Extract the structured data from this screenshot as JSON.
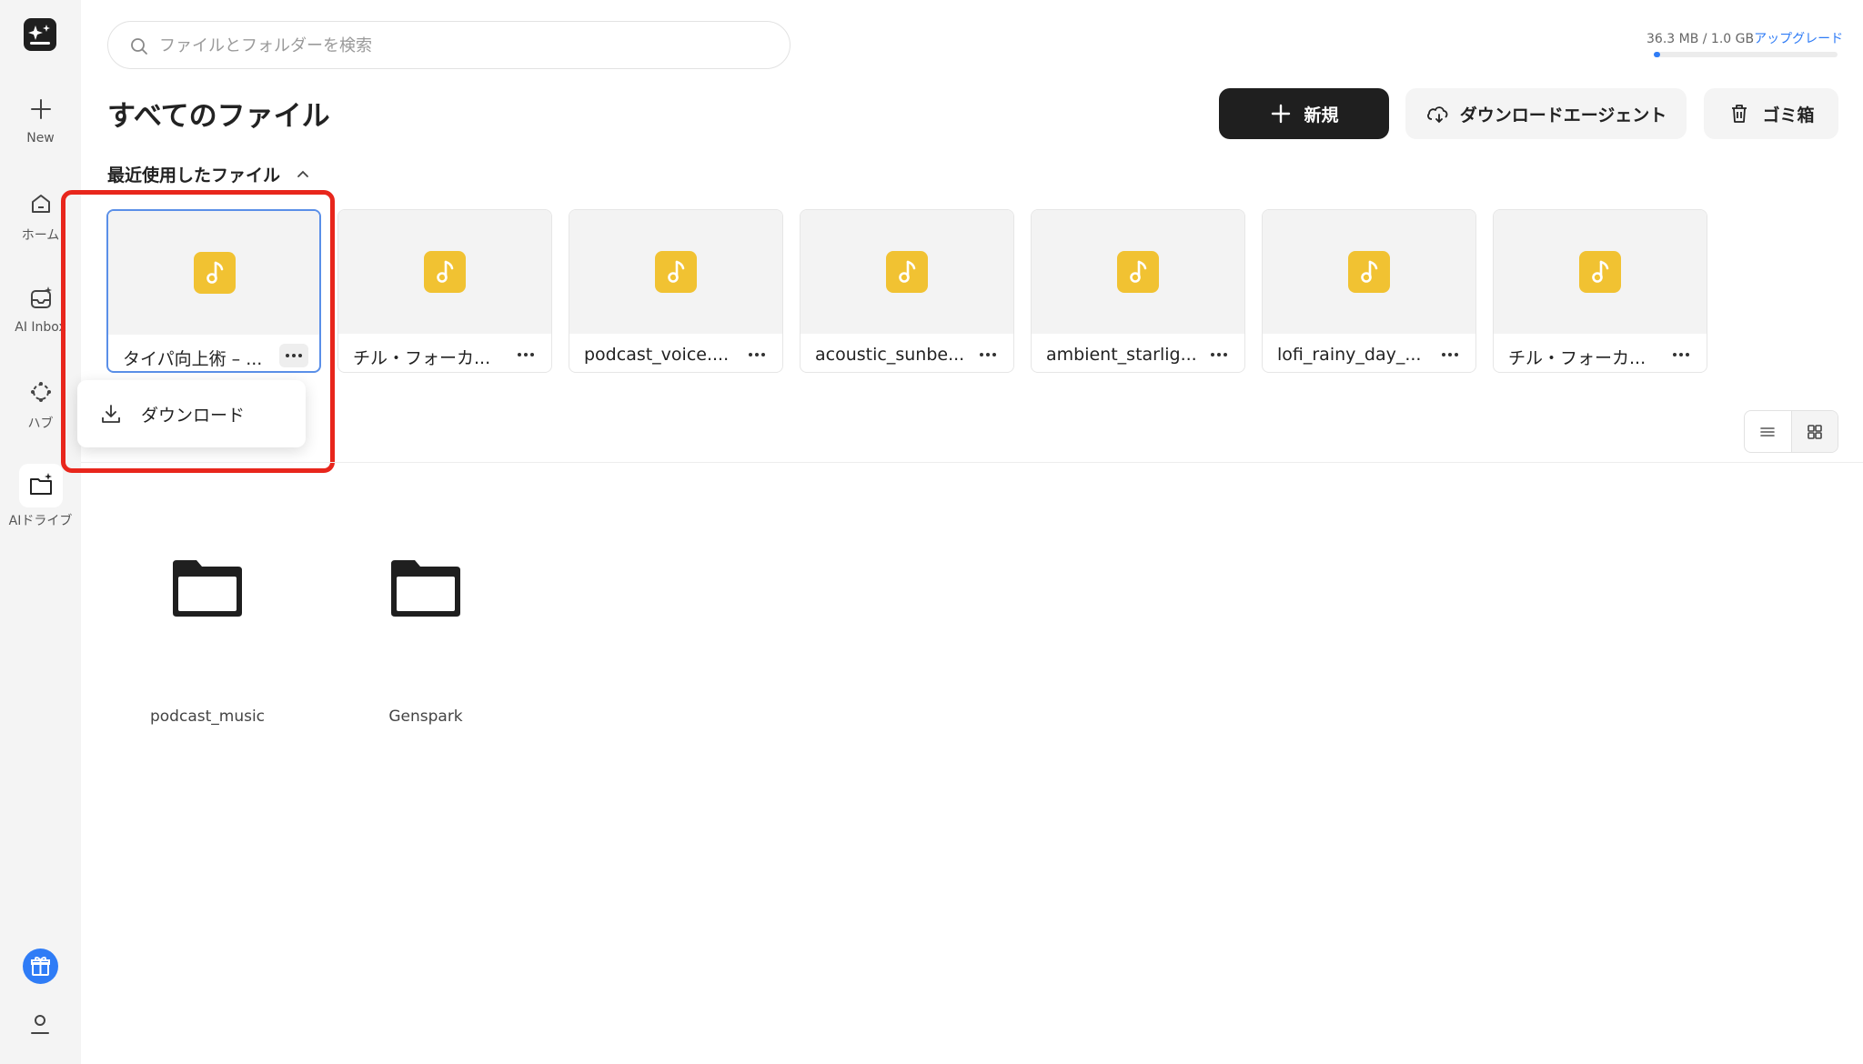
{
  "sidebar": {
    "logo_icon": "sparkle-logo-icon",
    "items": [
      {
        "label": "New",
        "icon": "plus-icon"
      },
      {
        "label": "ホーム",
        "icon": "home-icon"
      },
      {
        "label": "AI Inbox",
        "icon": "ai-inbox-icon"
      },
      {
        "label": "ハブ",
        "icon": "hub-icon"
      },
      {
        "label": "AIドライブ",
        "icon": "ai-drive-icon"
      }
    ],
    "gift_icon": "gift-icon",
    "user_icon": "user-icon"
  },
  "search": {
    "placeholder": "ファイルとフォルダーを検索"
  },
  "storage": {
    "usage": "36.3 MB / 1.0 GB",
    "upgrade": "アップグレード",
    "used_fraction": 0.035,
    "accent": "#2f7cf6"
  },
  "page": {
    "title": "すべてのファイル"
  },
  "toolbar": {
    "new_label": "新規",
    "agent_label": "ダウンロードエージェント",
    "trash_label": "ゴミ箱"
  },
  "recent": {
    "header": "最近使用したファイル",
    "files": [
      {
        "name": "タイパ向上術 – ..."
      },
      {
        "name": "チル・フォーカ..."
      },
      {
        "name": "podcast_voice...."
      },
      {
        "name": "acoustic_sunbe..."
      },
      {
        "name": "ambient_starlig..."
      },
      {
        "name": "lofi_rainy_day_..."
      },
      {
        "name": "チル・フォーカ..."
      }
    ]
  },
  "context_menu": {
    "download_label": "ダウンロード"
  },
  "folders": [
    {
      "name": "podcast_music"
    },
    {
      "name": "Genspark"
    }
  ],
  "colors": {
    "highlight": "#e8261c",
    "audio_icon": "#f1c232",
    "primary_button": "#1f1f1f"
  }
}
